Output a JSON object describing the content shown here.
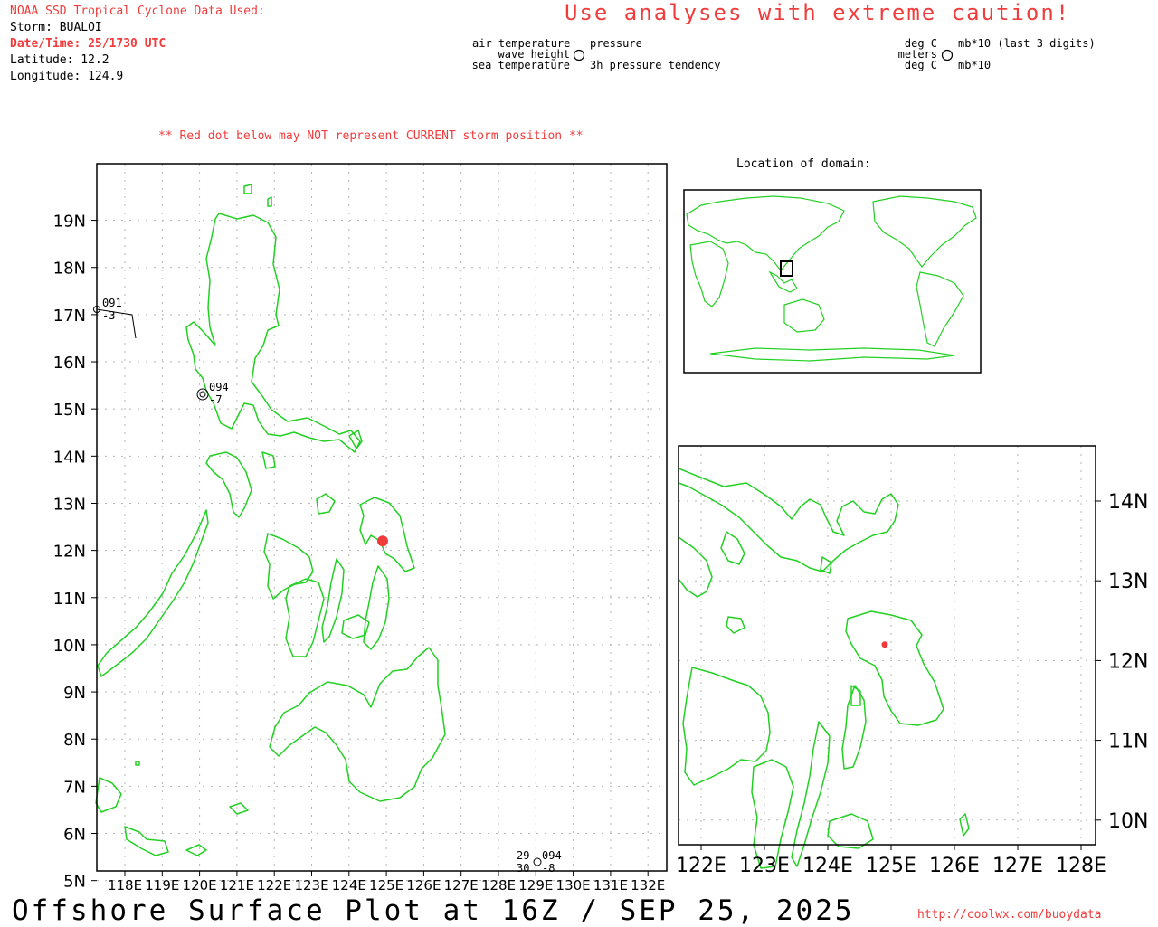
{
  "header": {
    "source": "NOAA SSD Tropical Cyclone Data Used:",
    "storm": "Storm: BUALOI",
    "datetime": "Date/Time: 25/1730 UTC",
    "latitude": "Latitude: 12.2",
    "longitude": "Longitude: 124.9",
    "caution": "Use analyses with extreme caution!"
  },
  "legend": {
    "left": {
      "air_temp": "air temperature",
      "wave_height": "wave height",
      "sea_temp": "sea temperature"
    },
    "right": {
      "pressure": "pressure",
      "tendency": "3h pressure tendency"
    },
    "units_left": {
      "deg1": "deg C",
      "meters": "meters",
      "deg2": "deg C"
    },
    "units_right": {
      "mb_last3": "mb*10 (last 3 digits)",
      "mb": "mb*10"
    }
  },
  "warning": "** Red dot below may NOT represent CURRENT storm position **",
  "main_map": {
    "lat_labels": [
      "19N",
      "18N",
      "17N",
      "16N",
      "15N",
      "14N",
      "13N",
      "12N",
      "11N",
      "10N",
      "9N",
      "8N",
      "7N",
      "6N",
      "5N"
    ],
    "lon_labels": [
      "118E",
      "119E",
      "120E",
      "121E",
      "122E",
      "123E",
      "124E",
      "125E",
      "126E",
      "127E",
      "128E",
      "129E",
      "130E",
      "131E",
      "132E"
    ],
    "storm": {
      "lat": 12.2,
      "lon": 124.9,
      "color": "#f03c3c"
    },
    "stations": [
      {
        "pressure": "091",
        "tendency": "-3"
      },
      {
        "pressure": "094",
        "tendency": "-7"
      },
      {
        "air_temp": "29",
        "sea_temp": "30",
        "pressure": "094",
        "tendency": "-8"
      }
    ]
  },
  "inset": {
    "title": "Location of domain:"
  },
  "zoom_map": {
    "lat_labels": [
      "14N",
      "13N",
      "12N",
      "11N",
      "10N"
    ],
    "lon_labels": [
      "122E",
      "123E",
      "124E",
      "125E",
      "126E",
      "127E",
      "128E"
    ]
  },
  "footer": {
    "title": "Offshore Surface Plot at 16Z / SEP 25, 2025",
    "url": "http://coolwx.com/buoydata"
  },
  "colors": {
    "coastline": "#22d022",
    "accent_red": "#f03c3c",
    "grid": "#b4b4b4"
  }
}
